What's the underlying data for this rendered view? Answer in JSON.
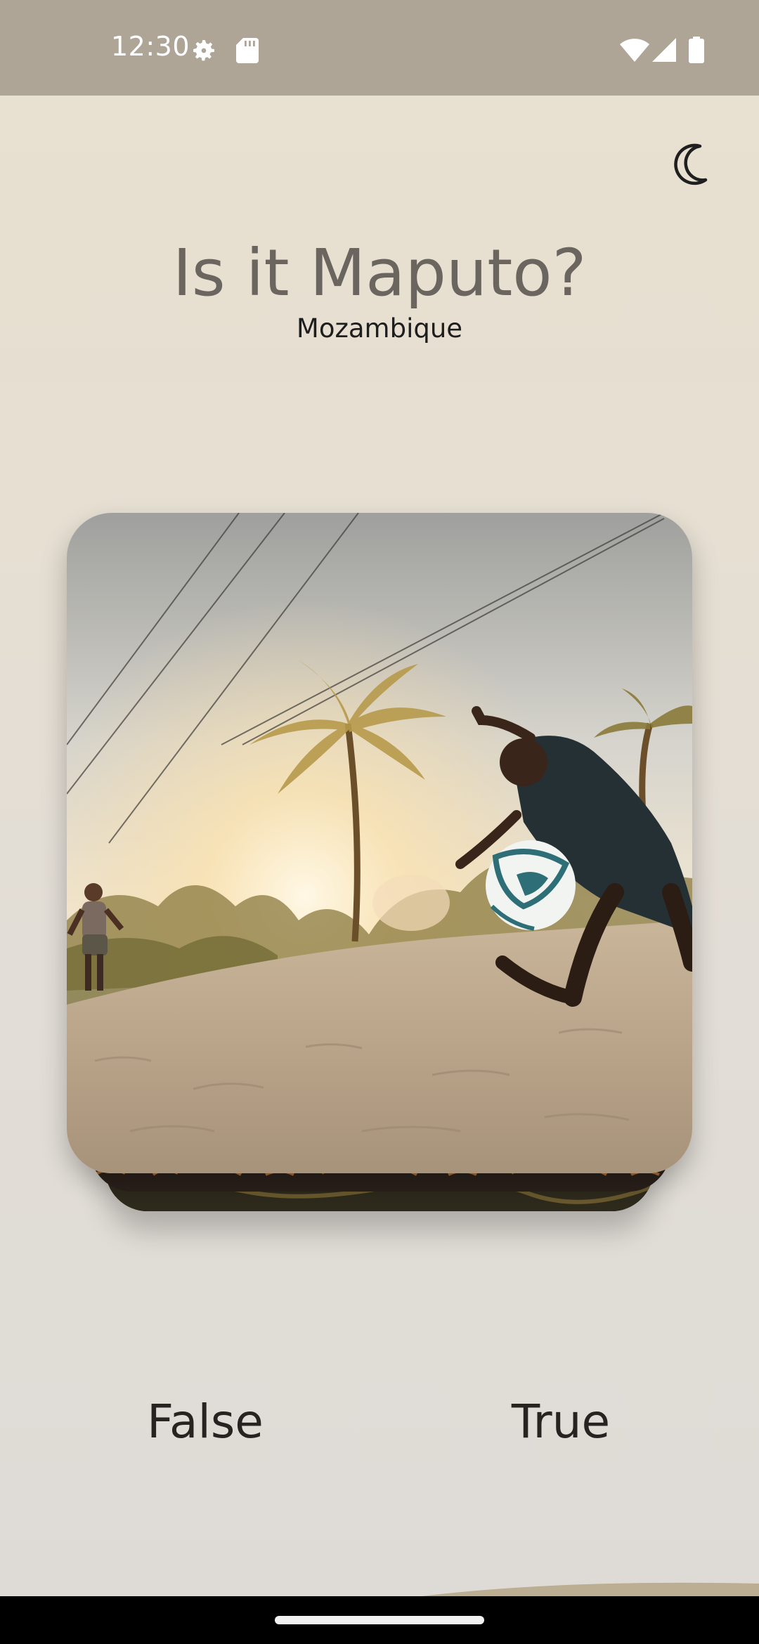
{
  "status_bar": {
    "time": "12:30",
    "icons_left": [
      "settings-icon",
      "sd-card-icon"
    ],
    "icons_right": [
      "wifi-icon",
      "cellular-signal-icon",
      "battery-icon"
    ]
  },
  "header": {
    "theme_toggle_icon": "moon-icon"
  },
  "question": {
    "title": "Is it Maputo?",
    "subtitle": "Mozambique"
  },
  "card": {
    "image": "photo-boy-kicking-football-on-sand-with-palm-trees"
  },
  "answers": {
    "false_label": "False",
    "true_label": "True"
  },
  "colors": {
    "status_bar": "#aea597",
    "title": "#6b655f",
    "background": "#e6dfd2",
    "nav_bar": "#000000"
  }
}
